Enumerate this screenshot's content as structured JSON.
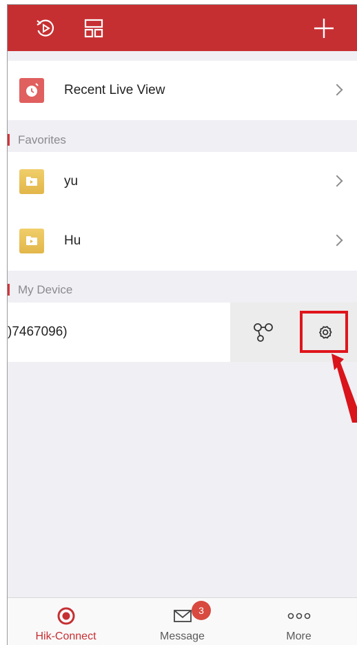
{
  "colors": {
    "accent": "#c62f32",
    "background": "#efeff4",
    "highlight": "#e0141c",
    "favorite_folder": "#e7c055",
    "recent_icon": "#e05f5f"
  },
  "top_bar": {
    "icons": [
      "playback-icon",
      "layout-icon",
      "add-icon"
    ]
  },
  "recent": {
    "label": "Recent Live View",
    "icon": "clock-icon"
  },
  "favorites": {
    "section_title": "Favorites",
    "items": [
      {
        "label": "yu",
        "icon": "folder-icon"
      },
      {
        "label": "Hu",
        "icon": "folder-icon"
      }
    ]
  },
  "my_device": {
    "section_title": "My Device",
    "device": {
      "label": ")7467096)",
      "actions": [
        "share-icon",
        "settings-icon"
      ]
    }
  },
  "bottom_nav": {
    "items": [
      {
        "label": "Hik-Connect",
        "icon": "hik-connect-icon",
        "active": true
      },
      {
        "label": "Message",
        "icon": "message-icon",
        "badge": "3"
      },
      {
        "label": "More",
        "icon": "more-icon"
      }
    ]
  }
}
